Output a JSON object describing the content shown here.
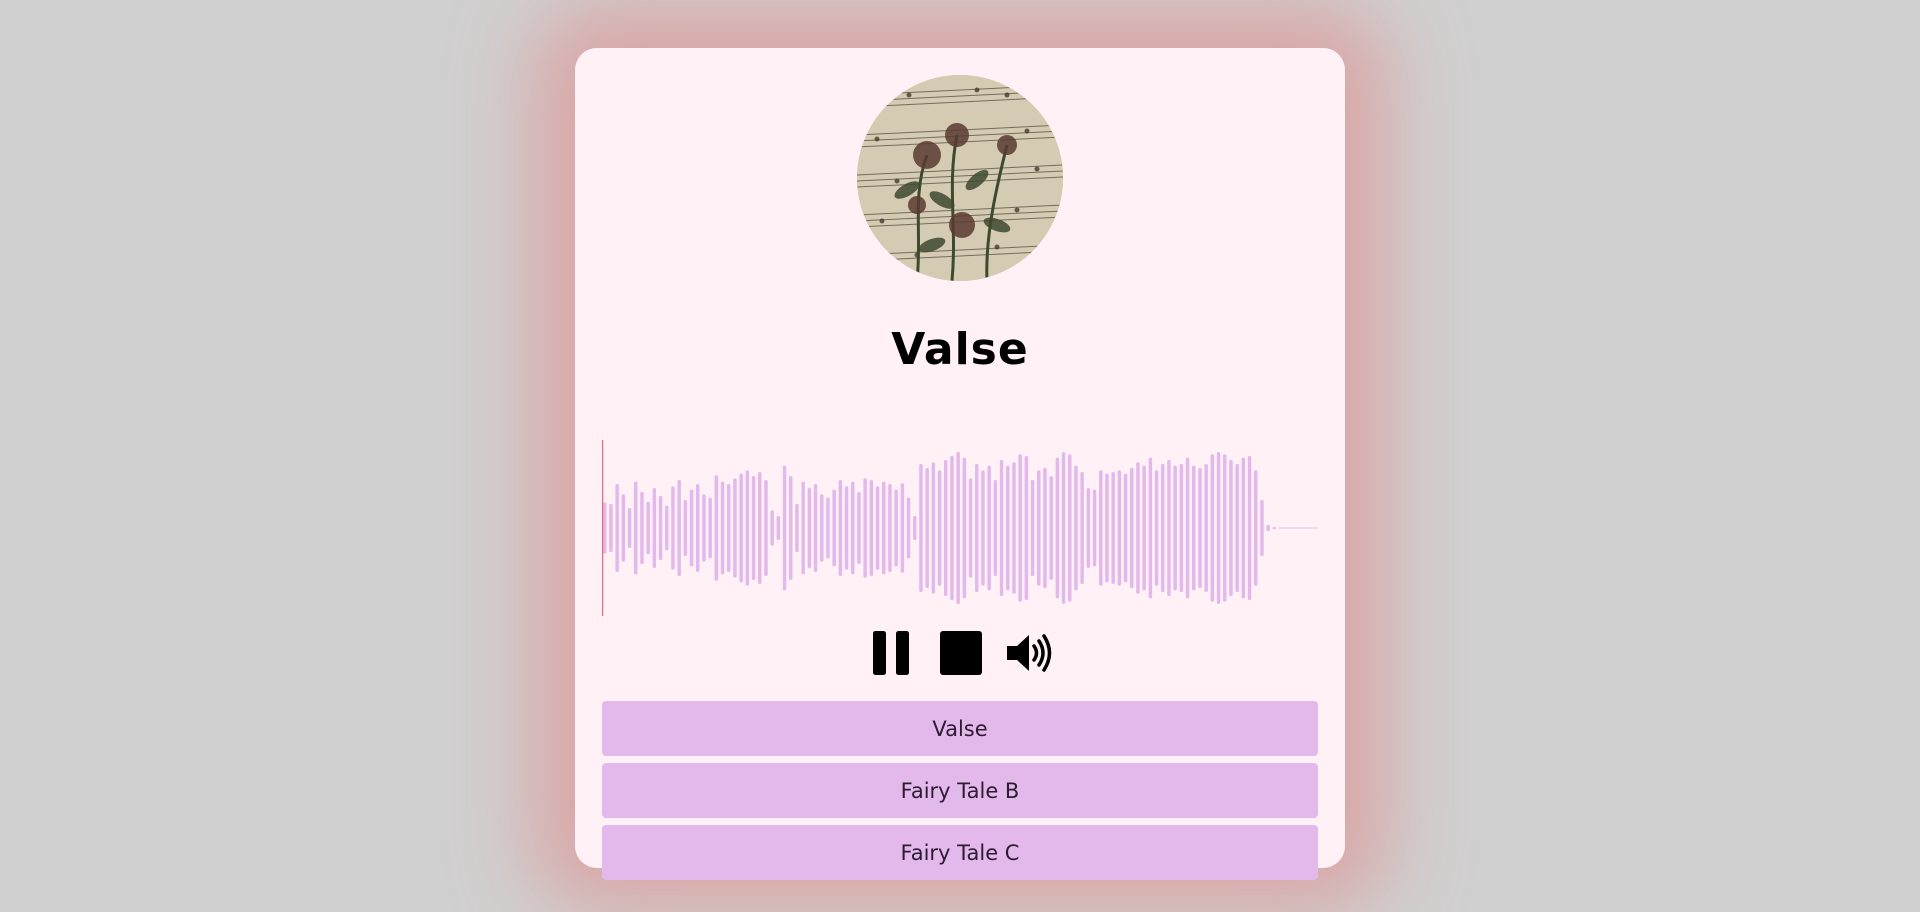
{
  "player": {
    "cover_image": "sheet-music-flowers-artwork",
    "track_title": "Valse",
    "progress": 0.0,
    "colors": {
      "background": "#d1d0d0",
      "card": "#fff1f6",
      "waveform": "#e3b9ec",
      "cursor": "#e07080",
      "track_button": "#e3b9ec",
      "glow": "#e28282"
    },
    "waveform_peaks": [
      0.32,
      0.3,
      0.55,
      0.42,
      0.25,
      0.58,
      0.45,
      0.33,
      0.5,
      0.4,
      0.28,
      0.52,
      0.6,
      0.35,
      0.48,
      0.55,
      0.42,
      0.38,
      0.66,
      0.58,
      0.55,
      0.62,
      0.68,
      0.72,
      0.65,
      0.7,
      0.6,
      0.22,
      0.15,
      0.78,
      0.65,
      0.3,
      0.58,
      0.5,
      0.55,
      0.42,
      0.38,
      0.48,
      0.6,
      0.52,
      0.58,
      0.45,
      0.62,
      0.6,
      0.52,
      0.58,
      0.55,
      0.48,
      0.56,
      0.38,
      0.15,
      0.8,
      0.75,
      0.82,
      0.72,
      0.85,
      0.9,
      0.95,
      0.88,
      0.62,
      0.8,
      0.72,
      0.78,
      0.6,
      0.85,
      0.78,
      0.82,
      0.92,
      0.9,
      0.6,
      0.72,
      0.75,
      0.65,
      0.88,
      0.95,
      0.92,
      0.78,
      0.7,
      0.5,
      0.48,
      0.72,
      0.68,
      0.7,
      0.72,
      0.68,
      0.75,
      0.82,
      0.78,
      0.88,
      0.72,
      0.8,
      0.85,
      0.78,
      0.8,
      0.88,
      0.78,
      0.75,
      0.8,
      0.92,
      0.95,
      0.92,
      0.85,
      0.8,
      0.88,
      0.9,
      0.72,
      0.35,
      0.04,
      0.0
    ]
  },
  "controls": {
    "pause_icon": "pause-icon",
    "stop_icon": "stop-icon",
    "volume_icon": "volume-high-icon"
  },
  "playlist": {
    "items": [
      {
        "label": "Valse"
      },
      {
        "label": "Fairy Tale B"
      },
      {
        "label": "Fairy Tale C"
      }
    ]
  }
}
